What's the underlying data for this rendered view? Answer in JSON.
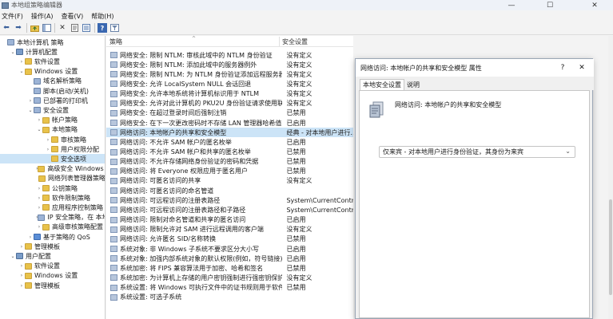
{
  "window": {
    "title": "本地组策略编辑器",
    "minimize": "—",
    "maximize": "☐",
    "close": "✕"
  },
  "menu": [
    "文件(F)",
    "操作(A)",
    "查看(V)",
    "帮助(H)"
  ],
  "toolbar": {
    "back": "⬅",
    "forward": "➡",
    "delete": "✕",
    "help": "?"
  },
  "tree": [
    {
      "label": "本地计算机 策略",
      "indent": 0,
      "arrow": "",
      "icon": "policy"
    },
    {
      "label": "计算机配置",
      "indent": 1,
      "arrow": "⌄",
      "icon": "comp"
    },
    {
      "label": "软件设置",
      "indent": 2,
      "arrow": "›",
      "icon": "folder"
    },
    {
      "label": "Windows 设置",
      "indent": 2,
      "arrow": "⌄",
      "icon": "folder"
    },
    {
      "label": "域名解析策略",
      "indent": 3,
      "arrow": "",
      "icon": "policy"
    },
    {
      "label": "脚本(启动/关机)",
      "indent": 3,
      "arrow": "",
      "icon": "policy"
    },
    {
      "label": "已部署的打印机",
      "indent": 3,
      "arrow": "›",
      "icon": "policy"
    },
    {
      "label": "安全设置",
      "indent": 3,
      "arrow": "⌄",
      "icon": "policy"
    },
    {
      "label": "帐户策略",
      "indent": 4,
      "arrow": "›",
      "icon": "folder"
    },
    {
      "label": "本地策略",
      "indent": 4,
      "arrow": "⌄",
      "icon": "folder"
    },
    {
      "label": "审核策略",
      "indent": 5,
      "arrow": "›",
      "icon": "folder"
    },
    {
      "label": "用户权限分配",
      "indent": 5,
      "arrow": "›",
      "icon": "folder"
    },
    {
      "label": "安全选项",
      "indent": 5,
      "arrow": "",
      "icon": "folder",
      "selected": true
    },
    {
      "label": "高级安全 Windows D",
      "indent": 4,
      "arrow": "›",
      "icon": "folder"
    },
    {
      "label": "网络列表管理器策略",
      "indent": 4,
      "arrow": "",
      "icon": "folder"
    },
    {
      "label": "公钥策略",
      "indent": 4,
      "arrow": "›",
      "icon": "folder"
    },
    {
      "label": "软件限制策略",
      "indent": 4,
      "arrow": "›",
      "icon": "folder"
    },
    {
      "label": "应用程序控制策略",
      "indent": 4,
      "arrow": "›",
      "icon": "folder"
    },
    {
      "label": "IP 安全策略，在 本地",
      "indent": 4,
      "arrow": "›",
      "icon": "policy"
    },
    {
      "label": "高级审核策略配置",
      "indent": 4,
      "arrow": "›",
      "icon": "folder"
    },
    {
      "label": "基于策略的 QoS",
      "indent": 3,
      "arrow": "›",
      "icon": "chart"
    },
    {
      "label": "管理模板",
      "indent": 2,
      "arrow": "›",
      "icon": "folder"
    },
    {
      "label": "用户配置",
      "indent": 1,
      "arrow": "⌄",
      "icon": "comp"
    },
    {
      "label": "软件设置",
      "indent": 2,
      "arrow": "›",
      "icon": "folder"
    },
    {
      "label": "Windows 设置",
      "indent": 2,
      "arrow": "›",
      "icon": "folder"
    },
    {
      "label": "管理模板",
      "indent": 2,
      "arrow": "›",
      "icon": "folder"
    }
  ],
  "list": {
    "col_policy": "策略",
    "col_setting": "安全设置",
    "sort_arrow": "^",
    "rows": [
      {
        "name": "网络安全: 限制 NTLM: 审核此域中的 NTLM 身份验证",
        "value": "没有定义"
      },
      {
        "name": "网络安全: 限制 NTLM: 添加此域中的服务器例外",
        "value": "没有定义"
      },
      {
        "name": "网络安全: 限制 NTLM: 为 NTLM 身份验证添加远程服务器...",
        "value": "没有定义"
      },
      {
        "name": "网络安全: 允许 LocalSystem NULL 会话回退",
        "value": "没有定义"
      },
      {
        "name": "网络安全: 允许本地系统将计算机标识用于 NTLM",
        "value": "没有定义"
      },
      {
        "name": "网络安全: 允许对此计算机的 PKU2U 身份验证请求使用联...",
        "value": "没有定义"
      },
      {
        "name": "网络安全: 在超过登录时间后强制注销",
        "value": "已禁用"
      },
      {
        "name": "网络安全: 在下一次更改密码时不存储 LAN 管理器哈希值",
        "value": "已启用"
      },
      {
        "name": "网络访问: 本地帐户的共享和安全模型",
        "value": "经典 - 对本地用户进行...",
        "selected": true
      },
      {
        "name": "网络访问: 不允许 SAM 帐户的匿名枚举",
        "value": "已启用"
      },
      {
        "name": "网络访问: 不允许 SAM 帐户和共享的匿名枚举",
        "value": "已禁用"
      },
      {
        "name": "网络访问: 不允许存储网络身份验证的密码和凭据",
        "value": "已禁用"
      },
      {
        "name": "网络访问: 将 Everyone 权限应用于匿名用户",
        "value": "已禁用"
      },
      {
        "name": "网络访问: 可匿名访问的共享",
        "value": "没有定义"
      },
      {
        "name": "网络访问: 可匿名访问的命名管道",
        "value": ""
      },
      {
        "name": "网络访问: 可远程访问的注册表路径",
        "value": "System\\CurrentContro..."
      },
      {
        "name": "网络访问: 可远程访问的注册表路径和子路径",
        "value": "System\\CurrentContro..."
      },
      {
        "name": "网络访问: 限制对命名管道和共享的匿名访问",
        "value": "已启用"
      },
      {
        "name": "网络访问: 限制允许对 SAM 进行远程调用的客户端",
        "value": "没有定义"
      },
      {
        "name": "网络访问: 允许匿名 SID/名称转换",
        "value": "已禁用"
      },
      {
        "name": "系统对象: 非 Windows 子系统不要求区分大小写",
        "value": "已启用"
      },
      {
        "name": "系统对象: 加强内部系统对象的默认权限(例如，符号链接)",
        "value": "已启用"
      },
      {
        "name": "系统加密: 将 FIPS 兼容算法用于加密、哈希和签名",
        "value": "已禁用"
      },
      {
        "name": "系统加密: 为计算机上存储的用户密钥强制进行强密钥保护",
        "value": "没有定义"
      },
      {
        "name": "系统设置: 将 Windows 可执行文件中的证书规则用于软件...",
        "value": "已禁用"
      },
      {
        "name": "系统设置: 可选子系统",
        "value": ""
      }
    ]
  },
  "dialog": {
    "title": "网络访问: 本地帐户的共享和安全模型 属性",
    "help": "?",
    "close": "✕",
    "tabs": [
      "本地安全设置",
      "说明"
    ],
    "policy_name": "网络访问: 本地帐户的共享和安全模型",
    "selected_option": "仅来宾 - 对本地用户进行身份验证，其身份为来宾",
    "chevron": "⌄"
  }
}
